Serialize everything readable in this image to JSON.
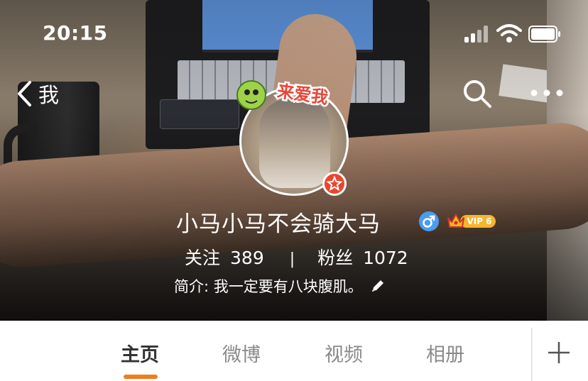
{
  "status_bar": {
    "time": "20:15"
  },
  "nav": {
    "back_label": "我",
    "icons": [
      "back-chevron-icon",
      "search-icon",
      "more-icon"
    ]
  },
  "profile": {
    "avatar_sticker_text": "来爱我",
    "username": "小马小马不会骑大马",
    "gender": "male",
    "vip_label": "VIP 6",
    "following_label": "关注",
    "following_count": "389",
    "stats_divider": "|",
    "followers_label": "粉丝",
    "followers_count": "1072",
    "bio": "简介: 我一定要有八块腹肌。"
  },
  "tabs": [
    {
      "label": "主页",
      "active": true
    },
    {
      "label": "微博",
      "active": false
    },
    {
      "label": "视频",
      "active": false
    },
    {
      "label": "相册",
      "active": false
    }
  ],
  "colors": {
    "tab_active_indicator": "#f07d1c",
    "verified_badge": "#e9462e",
    "gender_male": "#4b9cf1",
    "vip_gold": "#f6b52c"
  }
}
